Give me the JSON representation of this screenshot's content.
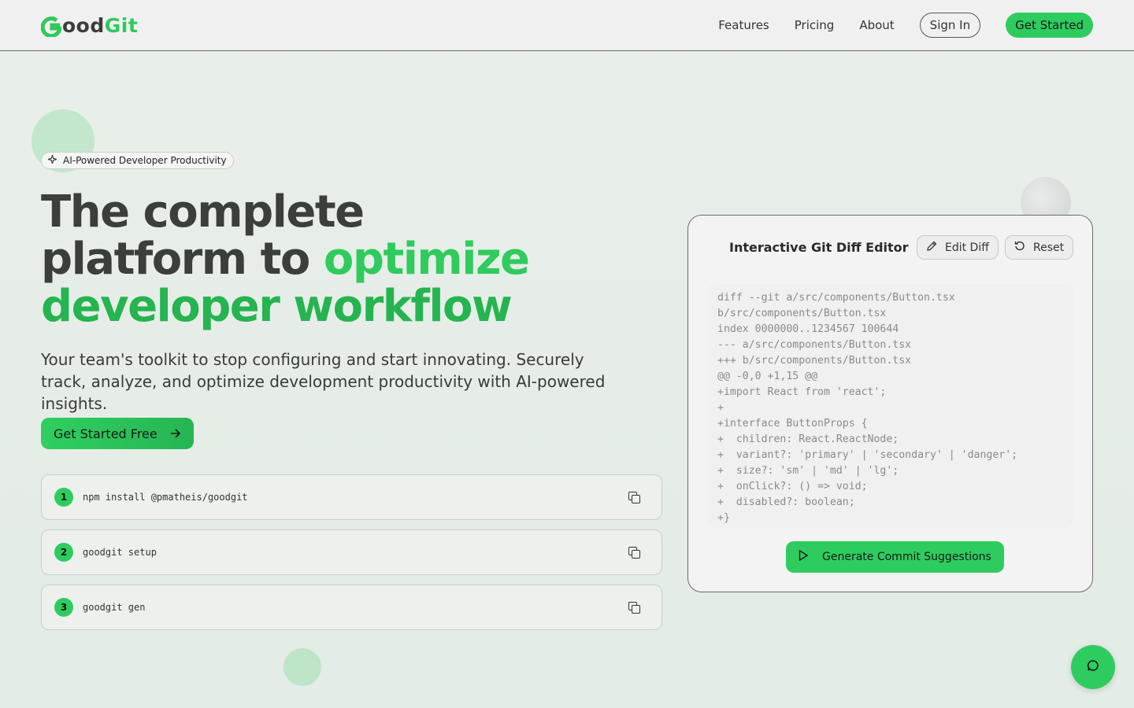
{
  "header": {
    "logo_good": "ood",
    "logo_git": "Git",
    "nav": [
      "Features",
      "Pricing",
      "About"
    ],
    "sign_in": "Sign In",
    "get_started": "Get Started"
  },
  "hero": {
    "badge": "AI-Powered Developer Productivity",
    "title_line1": "The complete",
    "title_line2_a": "platform to ",
    "title_line2_b": "optimize",
    "title_line3": "developer workflow",
    "subtitle": "Your team's toolkit to stop configuring and start innovating. Securely track, analyze, and optimize development productivity with AI-powered insights.",
    "cta": "Get Started Free"
  },
  "steps": [
    {
      "num": "1",
      "cmd": "npm install @pmatheis/goodgit"
    },
    {
      "num": "2",
      "cmd": "goodgit setup"
    },
    {
      "num": "3",
      "cmd": "goodgit gen"
    }
  ],
  "editor": {
    "title": "Interactive Git Diff Editor",
    "edit_label": "Edit Diff",
    "reset_label": "Reset",
    "diff": "diff --git a/src/components/Button.tsx\nb/src/components/Button.tsx\nindex 0000000..1234567 100644\n--- a/src/components/Button.tsx\n+++ b/src/components/Button.tsx\n@@ -0,0 +1,15 @@\n+import React from 'react';\n+\n+interface ButtonProps {\n+  children: React.ReactNode;\n+  variant?: 'primary' | 'secondary' | 'danger';\n+  size?: 'sm' | 'md' | 'lg';\n+  onClick?: () => void;\n+  disabled?: boolean;\n+}",
    "generate_label": "Generate Commit Suggestions"
  },
  "icons": {
    "badge": "sparkle-icon",
    "arrow": "arrow-right-icon",
    "copy": "copy-icon",
    "edit": "pencil-icon",
    "reset": "rotate-icon",
    "play": "play-icon",
    "chat": "chat-icon"
  },
  "colors": {
    "accent": "#2ecc5f",
    "accent_dark": "#25b44f",
    "text_dark": "#3b3f3c"
  }
}
